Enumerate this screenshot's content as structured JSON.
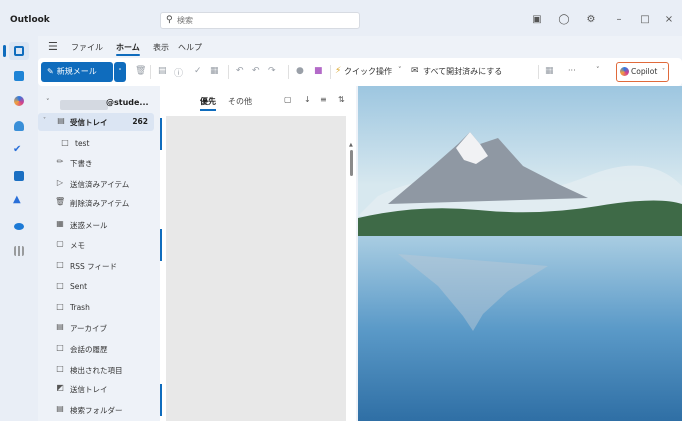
{
  "app": {
    "title": "Outlook"
  },
  "search": {
    "placeholder": "検索",
    "icon": "search-icon"
  },
  "titlebar_icons": [
    "feedback-icon",
    "bell-icon",
    "gear-icon",
    "minimize-icon",
    "maximize-icon",
    "close-icon"
  ],
  "menu": {
    "tabs": [
      {
        "label": "ファイル",
        "active": false
      },
      {
        "label": "ホーム",
        "active": true
      },
      {
        "label": "表示",
        "active": false
      },
      {
        "label": "ヘルプ",
        "active": false
      }
    ]
  },
  "ribbon": {
    "new_mail": "新規メール",
    "quick_steps": "クイック操作",
    "mark_all_read": "すべて開封済みにする",
    "more": "···",
    "copilot": "Copilot"
  },
  "account": {
    "name": "@stude..."
  },
  "folders": [
    {
      "label": "受信トレイ",
      "count": "262",
      "icon": "inbox-icon",
      "selected": true
    },
    {
      "label": "test",
      "icon": "folder-icon"
    },
    {
      "label": "下書き",
      "icon": "drafts-icon"
    },
    {
      "label": "送信済みアイテム",
      "icon": "send-icon"
    },
    {
      "label": "削除済みアイテム",
      "icon": "trash-icon"
    },
    {
      "label": "迷惑メール",
      "icon": "junk-icon"
    },
    {
      "label": "メモ",
      "icon": "note-icon"
    },
    {
      "label": "RSS フィード",
      "icon": "folder-icon"
    },
    {
      "label": "Sent",
      "icon": "folder-icon"
    },
    {
      "label": "Trash",
      "icon": "folder-icon"
    },
    {
      "label": "アーカイブ",
      "icon": "archive-icon"
    },
    {
      "label": "会話の履歴",
      "icon": "folder-icon"
    },
    {
      "label": "検出された項目",
      "icon": "folder-icon"
    },
    {
      "label": "送信トレイ",
      "icon": "outbox-icon"
    },
    {
      "label": "検索フォルダー",
      "icon": "search-folder-icon"
    }
  ],
  "message_list": {
    "focused": "優先",
    "other": "その他"
  },
  "colors": {
    "accent": "#0f6cbd",
    "copilot_border": "#e06a3b"
  }
}
